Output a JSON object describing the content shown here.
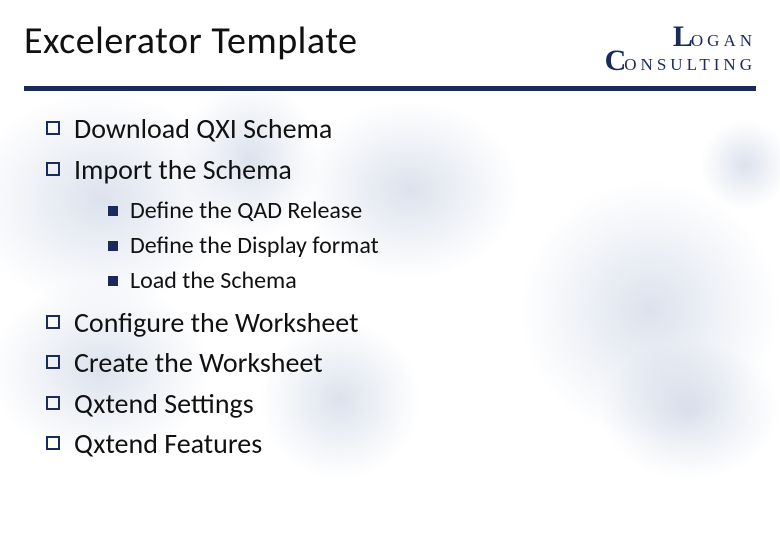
{
  "title": "Excelerator Template",
  "logo": {
    "l1_cap": "L",
    "l1_rest": "OGAN",
    "l2_cap": "C",
    "l2_rest": "ONSULTING"
  },
  "bullets": [
    {
      "text": "Download QXI Schema"
    },
    {
      "text": "Import the Schema",
      "sub": [
        {
          "text": "Define the QAD Release"
        },
        {
          "text": "Define the Display format"
        },
        {
          "text": "Load the Schema"
        }
      ]
    },
    {
      "text": "Configure the Worksheet"
    },
    {
      "text": "Create the Worksheet"
    },
    {
      "text": "Qxtend Settings"
    },
    {
      "text": "Qxtend Features"
    }
  ]
}
